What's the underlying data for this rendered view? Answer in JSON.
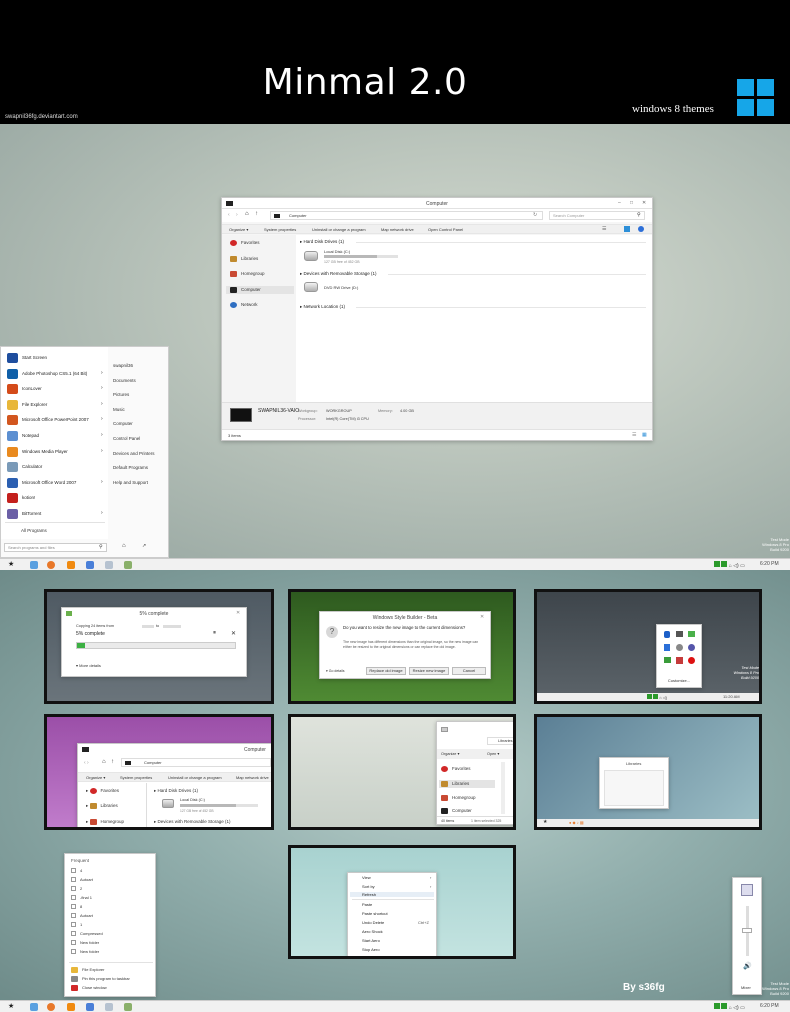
{
  "banner": {
    "title": "Minmal 2.0",
    "subtitle": "windows 8 themes",
    "site": "swapnil36fg.deviantart.com"
  },
  "explorer": {
    "title": "Computer",
    "address": "Computer",
    "search_placeholder": "Search Computer",
    "toolbar": [
      "Organize ▾",
      "System properties",
      "Uninstall or change a program",
      "Map network drive",
      "Open Control Panel"
    ],
    "nav": [
      "Favorites",
      "Libraries",
      "Homegroup",
      "Computer",
      "Network"
    ],
    "groups": {
      "hdd": "Hard Disk Drives (1)",
      "removable": "Devices with Removable Storage (1)",
      "network": "Network Location (1)"
    },
    "drives": {
      "local_name": "Local Disk (C:)",
      "local_free": "127 GB free of 452 GB",
      "dvd_name": "DVD RW Drive (D:)"
    },
    "details": {
      "pc_name": "SWAPNIL36-VAIO",
      "workgroup_label": "Workgroup:",
      "workgroup": "WORKGROUP",
      "memory_label": "Memory:",
      "memory": "4.00 GB",
      "processor_label": "Processor:",
      "processor": "Intel(R) Core(TM) i3 CPU"
    },
    "status": "3 items"
  },
  "start_menu": {
    "items": [
      {
        "label": "Start Screen",
        "arrow": "",
        "color": "#1f4e9e"
      },
      {
        "label": "Adobe Photoshop CS5.1 (64 Bit)",
        "arrow": "›",
        "color": "#0f5fa8"
      },
      {
        "label": "IconLover",
        "arrow": "›",
        "color": "#d44b1a"
      },
      {
        "label": "File Explorer",
        "arrow": "›",
        "color": "#e8b73a"
      },
      {
        "label": "Microsoft Office PowerPoint 2007",
        "arrow": "›",
        "color": "#d2561f"
      },
      {
        "label": "Notepad",
        "arrow": "›",
        "color": "#5c8fd1"
      },
      {
        "label": "Windows Media Player",
        "arrow": "›",
        "color": "#e98a1f"
      },
      {
        "label": "Calculator",
        "arrow": "",
        "color": "#7a9ab8"
      },
      {
        "label": "Microsoft Office Word 2007",
        "arrow": "›",
        "color": "#2b5fb1"
      },
      {
        "label": "kotion!",
        "arrow": "",
        "color": "#c4201d"
      },
      {
        "label": "BitTorrent",
        "arrow": "›",
        "color": "#6b5fa6"
      }
    ],
    "all_programs": "All Programs",
    "search_placeholder": "Search programs and files",
    "right": [
      "swapnil36",
      "Documents",
      "Pictures",
      "Music",
      "Computer",
      "Control Panel",
      "Devices and Printers",
      "Default Programs",
      "Help and Support"
    ]
  },
  "taskbar": {
    "watermark_lines": [
      "Test Mode",
      "Windows 8 Pro",
      "Build 9200"
    ],
    "clock": "6:20 PM"
  },
  "copy_dialog": {
    "title": "5% complete",
    "line1_prefix": "Copying 24 items from",
    "line1_suffix": "to",
    "percent": "5% complete",
    "pause_symbol": "⏸",
    "close_symbol": "✕",
    "more": "More details",
    "progress": 0.05
  },
  "style_builder": {
    "title": "Windows Style Builder - Beta",
    "question": "Do you want to resize the new image to the current dimensions?",
    "body": "The new image has different dimensions than the original image, so the new image can either be resized to the original dimensions or can replace the old image.",
    "details": "Go details",
    "buttons": [
      "Replace old image",
      "Resize new image",
      "Cancel"
    ]
  },
  "tray_popup": {
    "customize": "Customize...",
    "watermark_lines": [
      "Test Mode",
      "Windows 8 Pro",
      "Build 9200"
    ],
    "clock": "11:20 AM"
  },
  "mini_explorer": {
    "title": "Computer",
    "address": "Computer",
    "toolbar": [
      "Organize ▾",
      "System properties",
      "Uninstall or change a program",
      "Map network drive"
    ],
    "nav": [
      "Favorites",
      "Libraries",
      "Homegroup"
    ],
    "hdd": "Hard Disk Drives (1)",
    "local": "Local Disk (C:)",
    "local_free": "127 GB free of 452 GB",
    "removable": "Devices with Removable Storage (1)"
  },
  "libraries_window": {
    "address": "Libraries",
    "toolbar": [
      "Organize ▾",
      "Open ▾"
    ],
    "nav": [
      "Favorites",
      "Libraries",
      "Homegroup",
      "Computer"
    ],
    "status": "40 items",
    "selected": "1 item selected 325"
  },
  "small_libraries": {
    "title": "Libraries"
  },
  "jump_list": {
    "header": "Frequent",
    "items": [
      "4",
      "Autoart",
      "2",
      "-final 1",
      "8",
      "Autoart",
      "1",
      "Compressed",
      "New folder",
      "New folder"
    ],
    "actions": [
      "File Explorer",
      "Pin this program to taskbar",
      "Close window"
    ]
  },
  "context_menu": {
    "items": [
      {
        "label": "View",
        "arrow": "›",
        "shortcut": ""
      },
      {
        "label": "Sort by",
        "arrow": "›",
        "shortcut": ""
      },
      {
        "label": "Refresh",
        "arrow": "",
        "shortcut": ""
      },
      {
        "label": "Paste",
        "arrow": "",
        "shortcut": ""
      },
      {
        "label": "Paste shortcut",
        "arrow": "",
        "shortcut": ""
      },
      {
        "label": "Undo Delete",
        "arrow": "",
        "shortcut": "Ctrl+Z"
      },
      {
        "label": "Aero Shock",
        "arrow": "",
        "shortcut": ""
      },
      {
        "label": "Start Aero",
        "arrow": "",
        "shortcut": ""
      },
      {
        "label": "Stop Aero",
        "arrow": "",
        "shortcut": ""
      }
    ]
  },
  "mixer": {
    "label": "Mixer"
  },
  "signature": "By s36fg",
  "colors": {
    "win_blue": "#16a6e8",
    "desktop_top": "#bcc6bd",
    "desktop_bottom": "#91aeac",
    "frame": "#111111"
  }
}
